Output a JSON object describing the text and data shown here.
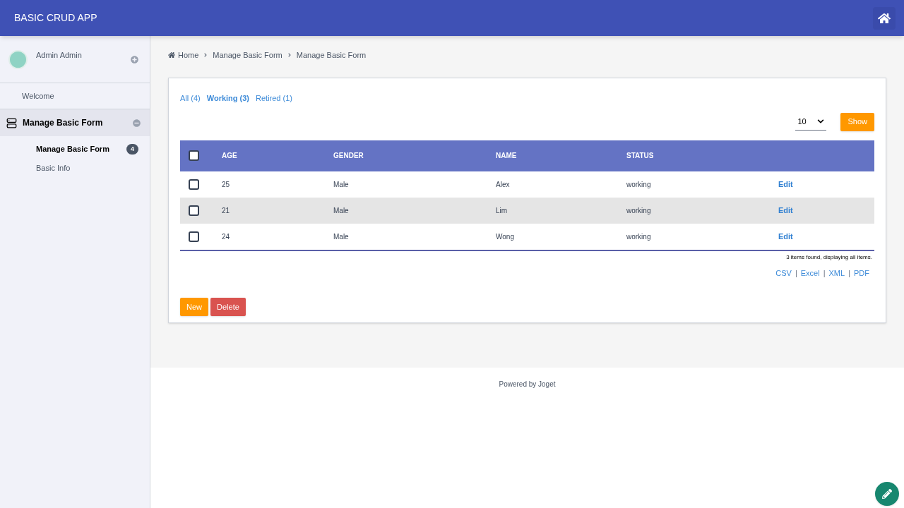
{
  "app_title": "BASIC CRUD APP",
  "user": {
    "name": "Admin Admin"
  },
  "sidebar": {
    "items": [
      {
        "label": "Welcome",
        "kind": "link"
      },
      {
        "label": "Manage Basic Form",
        "kind": "section",
        "expanded": true,
        "children": [
          {
            "label": "Manage Basic Form",
            "selected": true,
            "badge": "4"
          },
          {
            "label": "Basic Info",
            "selected": false
          }
        ]
      }
    ]
  },
  "breadcrumb": [
    "Home",
    "Manage Basic Form",
    "Manage Basic Form"
  ],
  "filters": [
    {
      "label": "All (4)",
      "selected": false
    },
    {
      "label": "Working (3)",
      "selected": true
    },
    {
      "label": "Retired (1)",
      "selected": false
    }
  ],
  "page_size": "10",
  "show_button": "Show",
  "table": {
    "select_all_checked": false,
    "columns": [
      "AGE",
      "GENDER",
      "NAME",
      "STATUS"
    ],
    "rows": [
      {
        "checked": false,
        "cells": [
          "25",
          "Male",
          "Alex",
          "working"
        ],
        "action": "Edit"
      },
      {
        "checked": false,
        "cells": [
          "21",
          "Male",
          "Lim",
          "working"
        ],
        "action": "Edit"
      },
      {
        "checked": false,
        "cells": [
          "24",
          "Male",
          "Wong",
          "working"
        ],
        "action": "Edit"
      }
    ]
  },
  "summary": "3 items found, displaying all items.",
  "exports": {
    "separator": "|",
    "links": [
      "CSV",
      "Excel",
      "XML",
      "PDF"
    ]
  },
  "buttons": [
    {
      "label": "New",
      "kind": "primary"
    },
    {
      "label": "Delete",
      "kind": "danger"
    }
  ],
  "footer": "Powered by Joget"
}
